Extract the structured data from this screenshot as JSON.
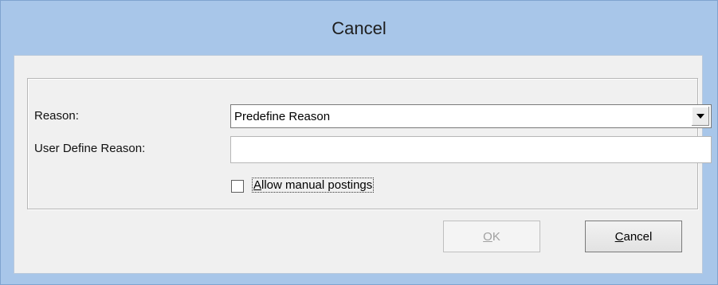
{
  "window": {
    "title": "Cancel"
  },
  "form": {
    "reason_label": "Reason:",
    "reason_value": "Predefine Reason",
    "user_reason_label": "User Define Reason:",
    "user_reason_value": "",
    "allow_manual_label": "Allow manual postings",
    "allow_manual_checked": false
  },
  "buttons": {
    "ok_label": "OK",
    "ok_mnemonic": "O",
    "ok_rest": "K",
    "ok_enabled": false,
    "cancel_mnemonic": "C",
    "cancel_rest": "ancel"
  },
  "icons": {
    "dropdown": "chevron-down-icon"
  },
  "colors": {
    "titlebar": "#a8c6e9",
    "client": "#f0f0f0",
    "disabled_text": "#a0a0a0"
  }
}
